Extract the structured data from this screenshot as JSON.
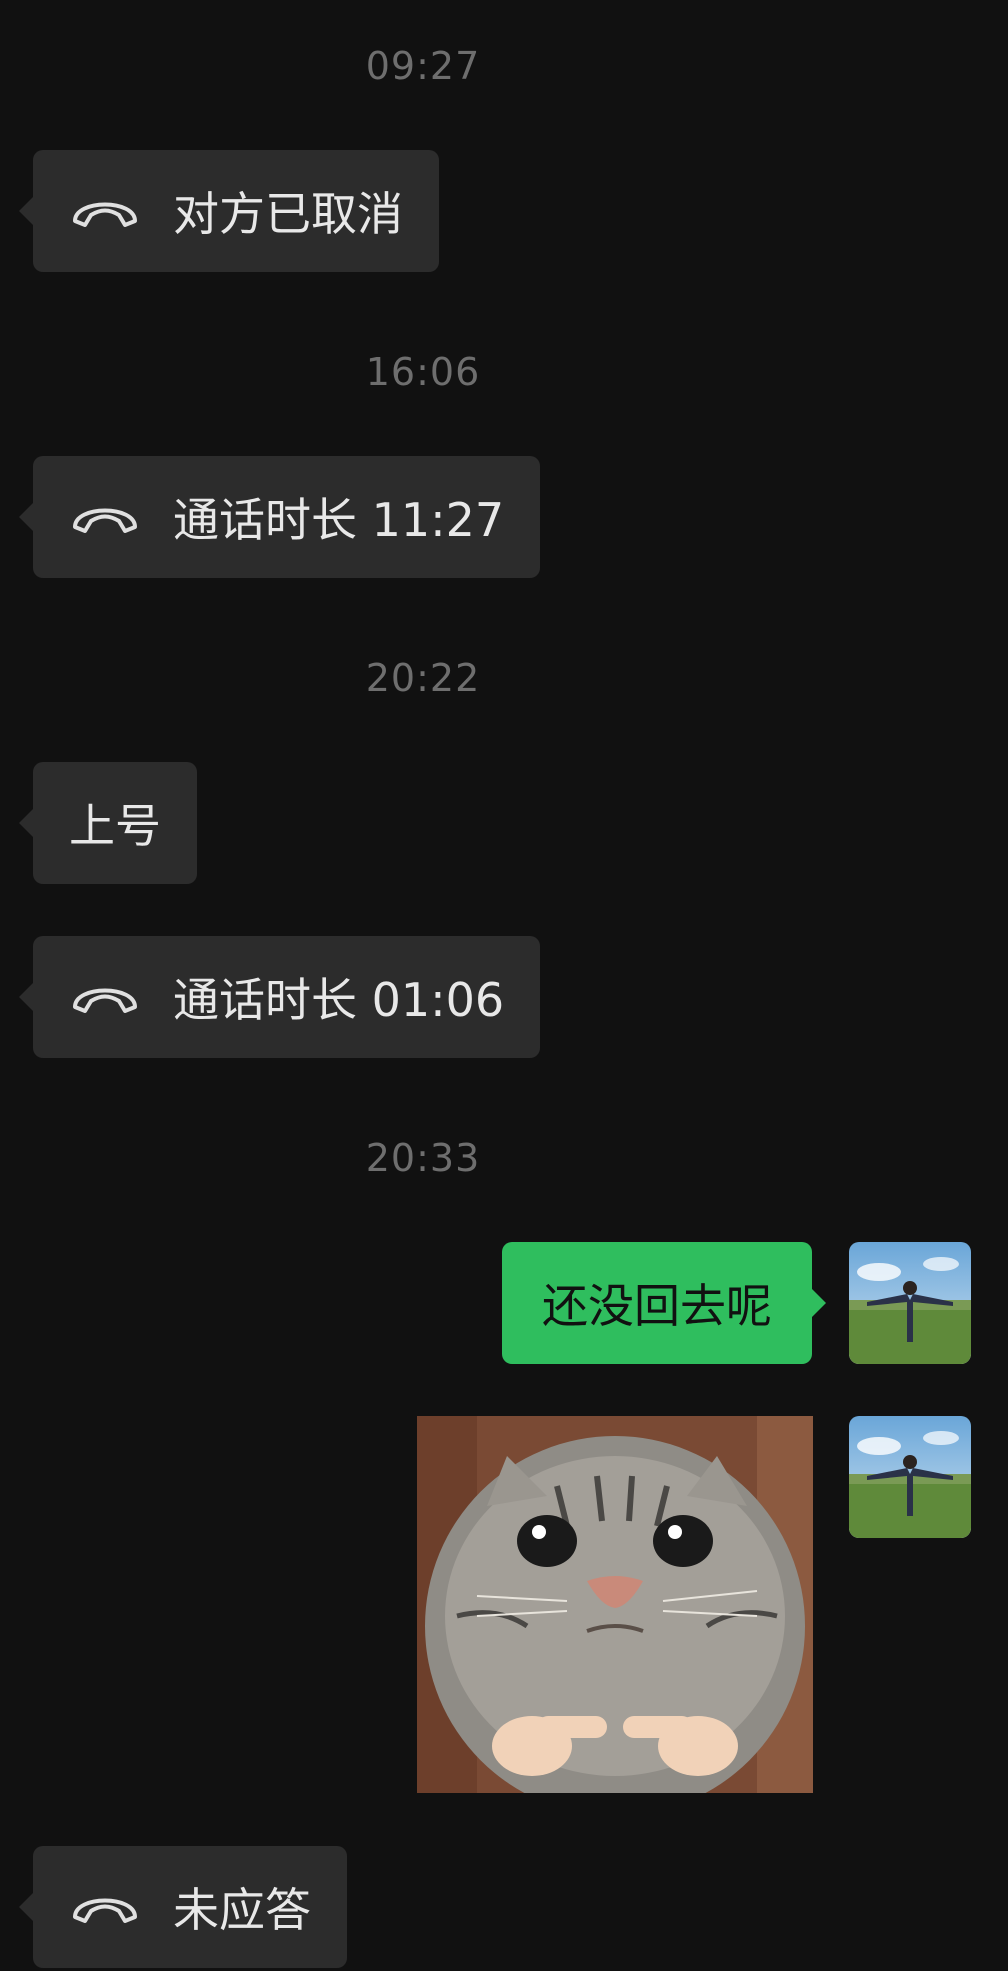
{
  "messages": [
    {
      "time": "09:27",
      "text": "对方已取消"
    },
    {
      "time": "16:06",
      "text": "通话时长 11:27"
    },
    {
      "time": "20:22",
      "text": "上号",
      "text2": "通话时长 01:06"
    },
    {
      "time": "20:33",
      "text": "还没回去呢"
    },
    {
      "text": "未应答"
    }
  ],
  "icons": {
    "call": "phone-hangup-icon",
    "avatar": "user-avatar",
    "sticker": "crying-cat-sticker"
  },
  "colors": {
    "background": "#111111",
    "bubble_incoming": "#2c2c2c",
    "bubble_outgoing": "#2fbe5e",
    "timestamp": "#6e6e6e"
  }
}
